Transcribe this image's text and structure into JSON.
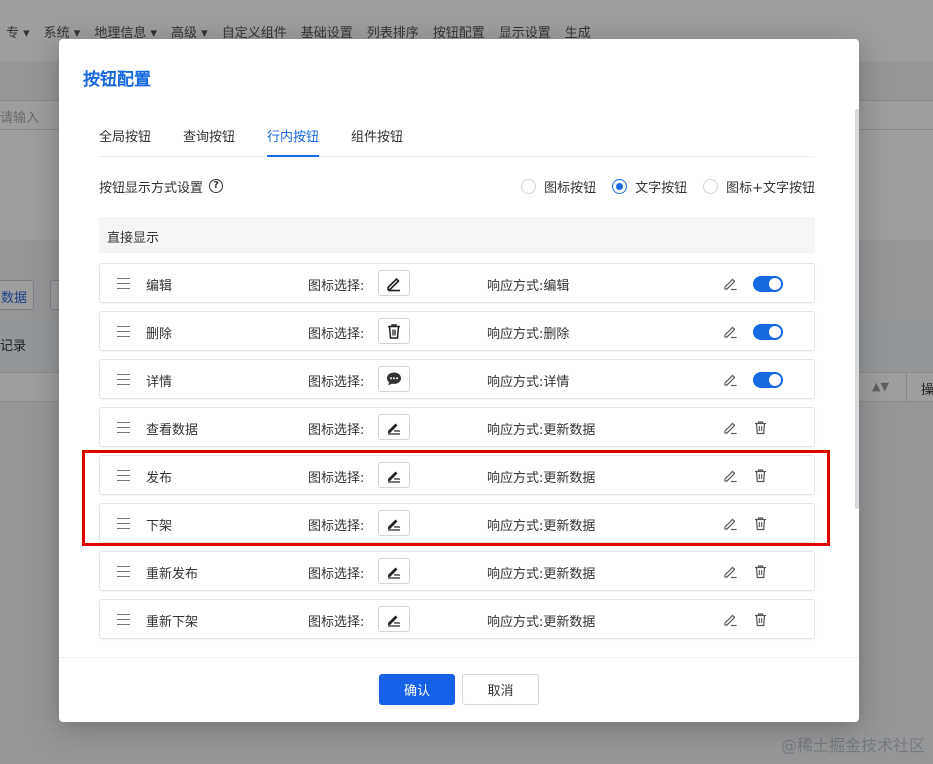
{
  "background": {
    "toolbar": [
      "专 ▾",
      "系统 ▾",
      "地理信息 ▾",
      "高级 ▾",
      "自定义组件",
      "基础设置",
      "列表排序",
      "按钮配置",
      "显示设置",
      "生成"
    ],
    "search_placeholder": "请输入",
    "data_button": "数据",
    "strip_text": "记录",
    "op_header": "操",
    "watermark": "@稀土掘金技术社区"
  },
  "modal": {
    "title": "按钮配置",
    "tabs": [
      {
        "label": "全局按钮",
        "active": false
      },
      {
        "label": "查询按钮",
        "active": false
      },
      {
        "label": "行内按钮",
        "active": true
      },
      {
        "label": "组件按钮",
        "active": false
      }
    ],
    "display_setting": {
      "label": "按钮显示方式设置",
      "options": [
        {
          "label": "图标按钮",
          "checked": false
        },
        {
          "label": "文字按钮",
          "checked": true
        },
        {
          "label": "图标+文字按钮",
          "checked": false
        }
      ]
    },
    "section_title": "直接显示",
    "icon_select_label": "图标选择:",
    "response_label": "响应方式:",
    "rows": [
      {
        "name": "编辑",
        "icon": "pencil-icon",
        "response": "编辑",
        "control": "toggle",
        "enabled": true
      },
      {
        "name": "删除",
        "icon": "trash-icon",
        "response": "删除",
        "control": "toggle",
        "enabled": true
      },
      {
        "name": "详情",
        "icon": "chat-bubble-icon",
        "response": "详情",
        "control": "toggle",
        "enabled": true
      },
      {
        "name": "查看数据",
        "icon": "edit-lines-icon",
        "response": "更新数据",
        "control": "delete"
      },
      {
        "name": "发布",
        "icon": "edit-lines-icon",
        "response": "更新数据",
        "control": "delete"
      },
      {
        "name": "下架",
        "icon": "edit-lines-icon",
        "response": "更新数据",
        "control": "delete"
      },
      {
        "name": "重新发布",
        "icon": "edit-lines-icon",
        "response": "更新数据",
        "control": "delete"
      },
      {
        "name": "重新下架",
        "icon": "edit-lines-icon",
        "response": "更新数据",
        "control": "delete"
      }
    ],
    "confirm_label": "确认",
    "cancel_label": "取消",
    "highlight_color": "#e00000",
    "accent_color": "#1769e0"
  }
}
